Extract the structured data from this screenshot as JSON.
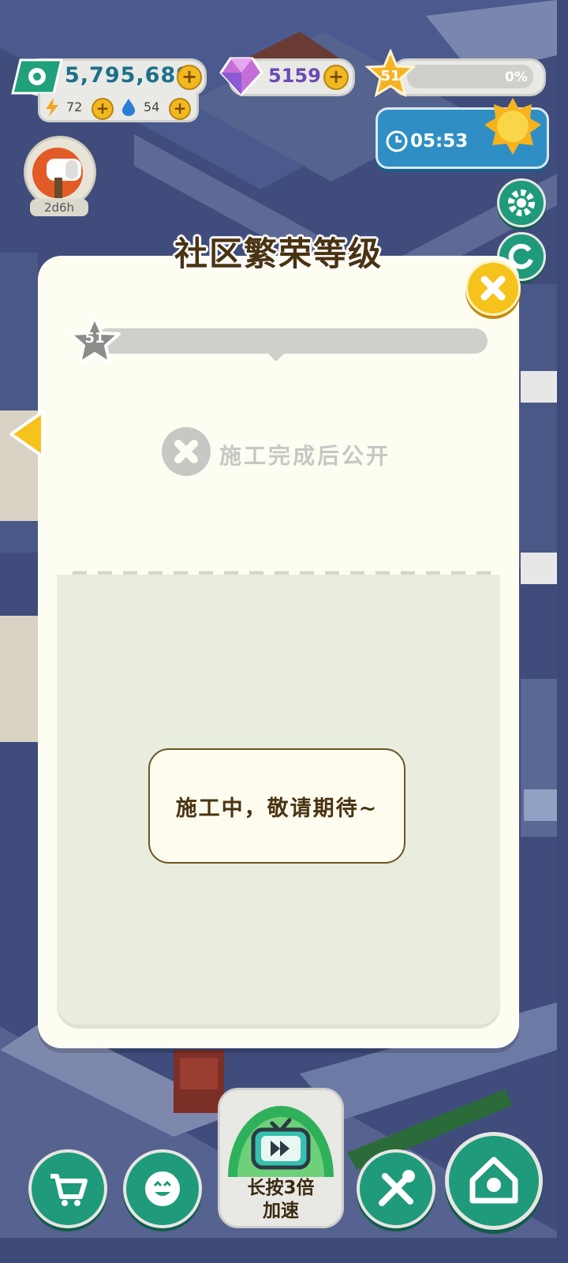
{
  "hud": {
    "cash": "5,795,689",
    "energy": "72",
    "water": "54",
    "gems": "5159",
    "level": "51",
    "level_percent": "0%",
    "level_progress": 0,
    "timer": "05:53",
    "worker_timer": "2d6h"
  },
  "modal": {
    "title": "社区繁荣等级",
    "level": "51",
    "progress": 0,
    "locked_text": "施工完成后公开",
    "bubble_text": "施工中，敬请期待~"
  },
  "bottom": {
    "speed_line1": "长按3倍",
    "speed_line2": "加速"
  },
  "colors": {
    "teal": "#1f9a7a",
    "gold": "#f6c21c",
    "panel": "#fdfdf1",
    "inner": "#e8eddd",
    "title_brown": "#4a3312"
  },
  "icons": [
    "cash-icon",
    "energy-icon",
    "water-drop-icon",
    "gem-icon",
    "star-icon",
    "clock-icon",
    "sun-icon",
    "gear-icon",
    "refresh-icon",
    "close-icon",
    "chevron-left-icon",
    "lock-x-icon",
    "cart-icon",
    "smile-icon",
    "tv-fast-forward-icon",
    "tools-icon",
    "home-wrench-icon"
  ]
}
